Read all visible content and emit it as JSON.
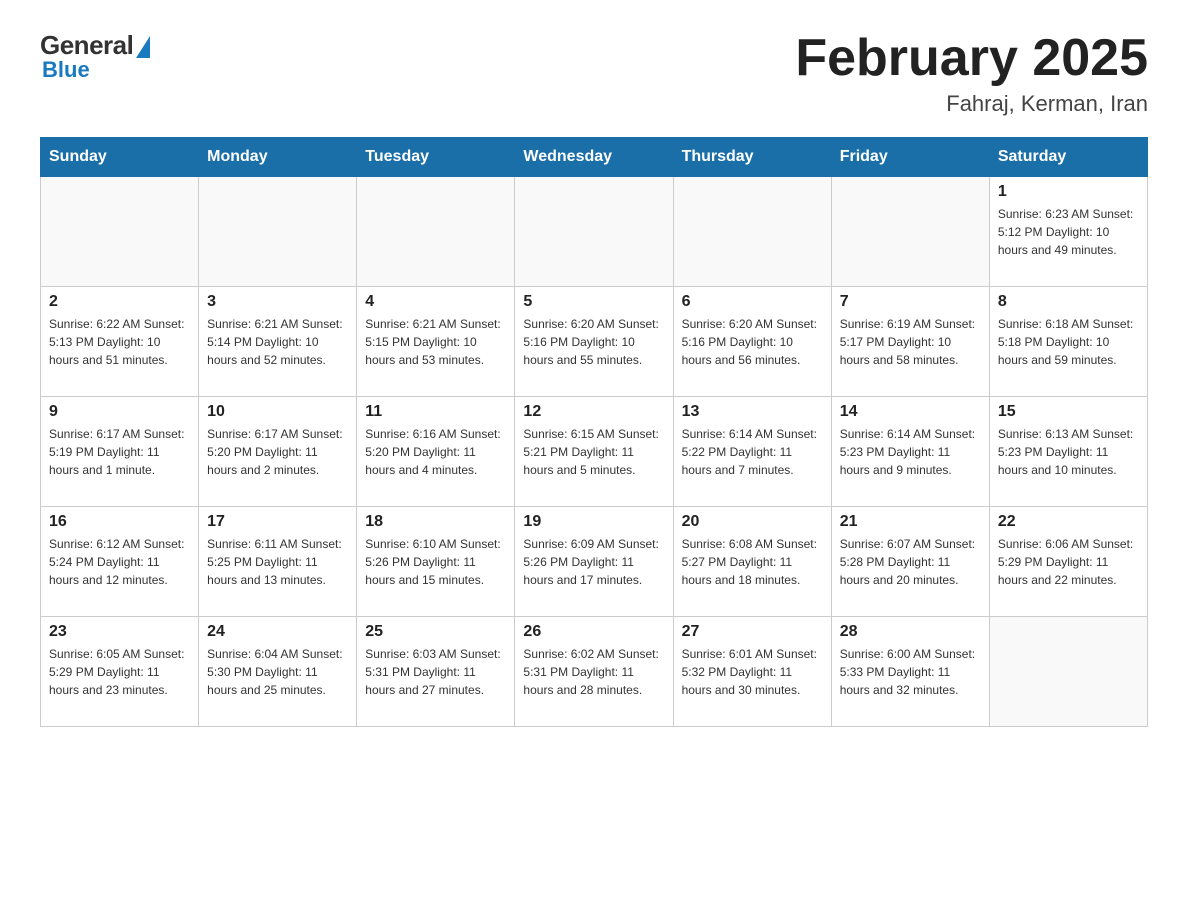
{
  "logo": {
    "general_text": "General",
    "blue_text": "Blue"
  },
  "title": "February 2025",
  "subtitle": "Fahraj, Kerman, Iran",
  "days_of_week": [
    "Sunday",
    "Monday",
    "Tuesday",
    "Wednesday",
    "Thursday",
    "Friday",
    "Saturday"
  ],
  "weeks": [
    {
      "days": [
        {
          "number": "",
          "info": ""
        },
        {
          "number": "",
          "info": ""
        },
        {
          "number": "",
          "info": ""
        },
        {
          "number": "",
          "info": ""
        },
        {
          "number": "",
          "info": ""
        },
        {
          "number": "",
          "info": ""
        },
        {
          "number": "1",
          "info": "Sunrise: 6:23 AM\nSunset: 5:12 PM\nDaylight: 10 hours and 49 minutes."
        }
      ]
    },
    {
      "days": [
        {
          "number": "2",
          "info": "Sunrise: 6:22 AM\nSunset: 5:13 PM\nDaylight: 10 hours and 51 minutes."
        },
        {
          "number": "3",
          "info": "Sunrise: 6:21 AM\nSunset: 5:14 PM\nDaylight: 10 hours and 52 minutes."
        },
        {
          "number": "4",
          "info": "Sunrise: 6:21 AM\nSunset: 5:15 PM\nDaylight: 10 hours and 53 minutes."
        },
        {
          "number": "5",
          "info": "Sunrise: 6:20 AM\nSunset: 5:16 PM\nDaylight: 10 hours and 55 minutes."
        },
        {
          "number": "6",
          "info": "Sunrise: 6:20 AM\nSunset: 5:16 PM\nDaylight: 10 hours and 56 minutes."
        },
        {
          "number": "7",
          "info": "Sunrise: 6:19 AM\nSunset: 5:17 PM\nDaylight: 10 hours and 58 minutes."
        },
        {
          "number": "8",
          "info": "Sunrise: 6:18 AM\nSunset: 5:18 PM\nDaylight: 10 hours and 59 minutes."
        }
      ]
    },
    {
      "days": [
        {
          "number": "9",
          "info": "Sunrise: 6:17 AM\nSunset: 5:19 PM\nDaylight: 11 hours and 1 minute."
        },
        {
          "number": "10",
          "info": "Sunrise: 6:17 AM\nSunset: 5:20 PM\nDaylight: 11 hours and 2 minutes."
        },
        {
          "number": "11",
          "info": "Sunrise: 6:16 AM\nSunset: 5:20 PM\nDaylight: 11 hours and 4 minutes."
        },
        {
          "number": "12",
          "info": "Sunrise: 6:15 AM\nSunset: 5:21 PM\nDaylight: 11 hours and 5 minutes."
        },
        {
          "number": "13",
          "info": "Sunrise: 6:14 AM\nSunset: 5:22 PM\nDaylight: 11 hours and 7 minutes."
        },
        {
          "number": "14",
          "info": "Sunrise: 6:14 AM\nSunset: 5:23 PM\nDaylight: 11 hours and 9 minutes."
        },
        {
          "number": "15",
          "info": "Sunrise: 6:13 AM\nSunset: 5:23 PM\nDaylight: 11 hours and 10 minutes."
        }
      ]
    },
    {
      "days": [
        {
          "number": "16",
          "info": "Sunrise: 6:12 AM\nSunset: 5:24 PM\nDaylight: 11 hours and 12 minutes."
        },
        {
          "number": "17",
          "info": "Sunrise: 6:11 AM\nSunset: 5:25 PM\nDaylight: 11 hours and 13 minutes."
        },
        {
          "number": "18",
          "info": "Sunrise: 6:10 AM\nSunset: 5:26 PM\nDaylight: 11 hours and 15 minutes."
        },
        {
          "number": "19",
          "info": "Sunrise: 6:09 AM\nSunset: 5:26 PM\nDaylight: 11 hours and 17 minutes."
        },
        {
          "number": "20",
          "info": "Sunrise: 6:08 AM\nSunset: 5:27 PM\nDaylight: 11 hours and 18 minutes."
        },
        {
          "number": "21",
          "info": "Sunrise: 6:07 AM\nSunset: 5:28 PM\nDaylight: 11 hours and 20 minutes."
        },
        {
          "number": "22",
          "info": "Sunrise: 6:06 AM\nSunset: 5:29 PM\nDaylight: 11 hours and 22 minutes."
        }
      ]
    },
    {
      "days": [
        {
          "number": "23",
          "info": "Sunrise: 6:05 AM\nSunset: 5:29 PM\nDaylight: 11 hours and 23 minutes."
        },
        {
          "number": "24",
          "info": "Sunrise: 6:04 AM\nSunset: 5:30 PM\nDaylight: 11 hours and 25 minutes."
        },
        {
          "number": "25",
          "info": "Sunrise: 6:03 AM\nSunset: 5:31 PM\nDaylight: 11 hours and 27 minutes."
        },
        {
          "number": "26",
          "info": "Sunrise: 6:02 AM\nSunset: 5:31 PM\nDaylight: 11 hours and 28 minutes."
        },
        {
          "number": "27",
          "info": "Sunrise: 6:01 AM\nSunset: 5:32 PM\nDaylight: 11 hours and 30 minutes."
        },
        {
          "number": "28",
          "info": "Sunrise: 6:00 AM\nSunset: 5:33 PM\nDaylight: 11 hours and 32 minutes."
        },
        {
          "number": "",
          "info": ""
        }
      ]
    }
  ]
}
